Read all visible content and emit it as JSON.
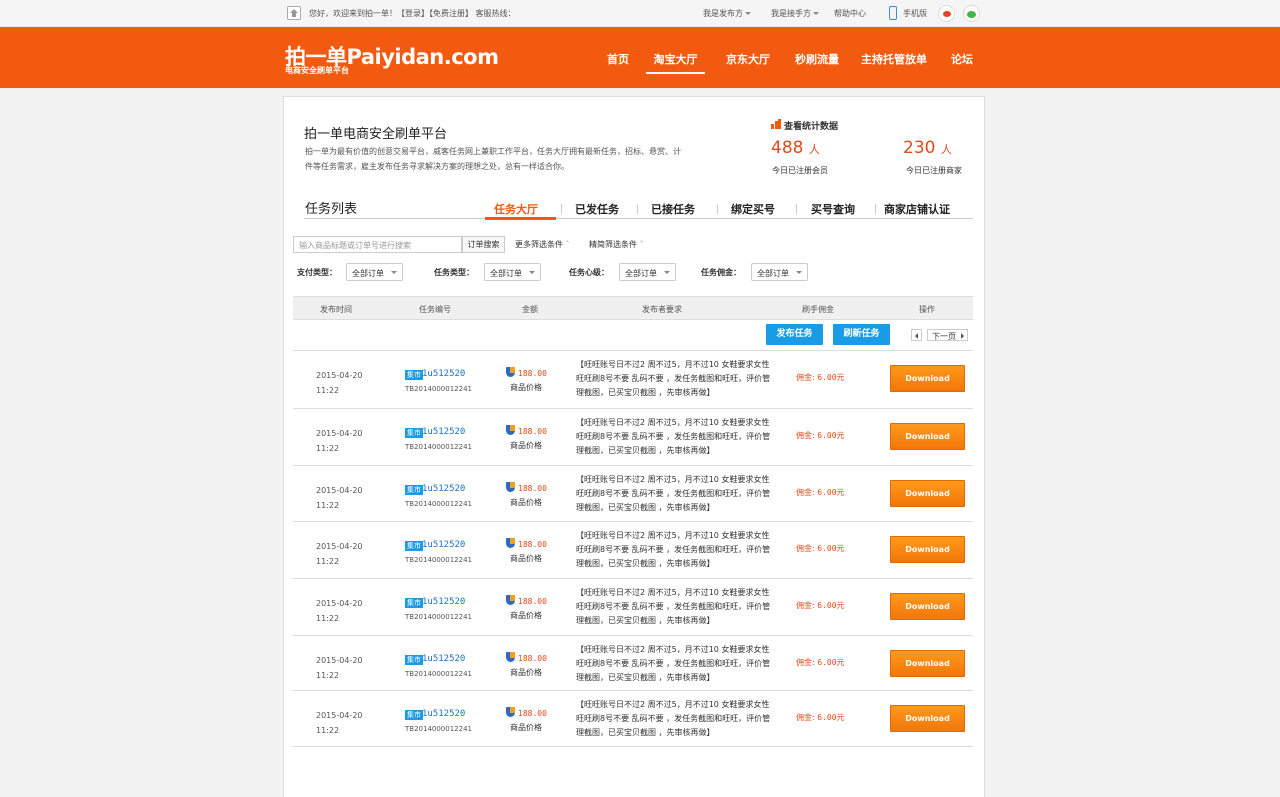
{
  "topbar": {
    "welcome": "您好，欢迎来到拍一单！【登录】【免费注册】",
    "hotline": "客服热线：",
    "links": [
      "我是发布方",
      "我是接手方",
      "帮助中心",
      "手机版"
    ]
  },
  "header": {
    "logo": "拍一单Paiyidan.com",
    "slogan": "电商安全刷单平台",
    "nav": [
      "首页",
      "淘宝大厅",
      "京东大厅",
      "秒刷流量",
      "主持托管放单",
      "论坛"
    ]
  },
  "intro": {
    "title": "拍一单电商安全刷单平台",
    "text": "拍一单为最有价值的创意交易平台，威客任务网上兼职工作平台，任务大厅拥有最新任务，招标、悬赏、计件等任务需求，雇主发布任务寻求解决方案的理想之处，总有一样适合你。"
  },
  "stats": {
    "title": "查看统计数据",
    "members_num": "488",
    "members_unit": "人",
    "members_label": "今日已注册会员",
    "merchants_num": "230",
    "merchants_unit": "人",
    "merchants_label": "今日已注册商家"
  },
  "task_list": {
    "title": "任务列表",
    "tabs": [
      "任务大厅",
      "已发任务",
      "已接任务",
      "绑定买号",
      "买号查询",
      "商家店铺认证"
    ]
  },
  "filters": {
    "search_placeholder": "输入商品标题或订单号进行搜索",
    "search_button": "订单搜索",
    "more": "更多筛选条件",
    "fine": "精简筛选条件",
    "labels": [
      "支付类型：",
      "任务类型：",
      "任务心级：",
      "任务佣金："
    ],
    "values": [
      "全部订单",
      "全部订单",
      "全部订单",
      "全部订单"
    ]
  },
  "table": {
    "headers": [
      "发布时间",
      "任务编号",
      "金额",
      "发布者要求",
      "刷手佣金",
      "操作"
    ],
    "publish_button": "发布任务",
    "refresh_button": "刷新任务",
    "next_page": "下一页",
    "rows": [
      {
        "date": "2015-04-20",
        "time": "11:22",
        "tag": "集市",
        "id": "1u512520",
        "tb": "TB2014000012241",
        "price": "188.00",
        "price_label": "商品价格",
        "req": "【旺旺账号日不过2 周不过5，月不过10 女鞋要求女性旺旺刷8号不要 乱码不要 ，发任务截图和旺旺，评价管理截图，已买宝贝截图 ，先审核再做】",
        "comm_label": "佣金:",
        "comm": "6.00元",
        "action": "Download"
      },
      {
        "date": "2015-04-20",
        "time": "11:22",
        "tag": "集市",
        "id": "1u512520",
        "tb": "TB2014000012241",
        "price": "188.00",
        "price_label": "商品价格",
        "req": "【旺旺账号日不过2 周不过5，月不过10 女鞋要求女性旺旺刷8号不要 乱码不要 ，发任务截图和旺旺，评价管理截图，已买宝贝截图 ，先审核再做】",
        "comm_label": "佣金:",
        "comm": "6.00元",
        "action": "Download"
      },
      {
        "date": "2015-04-20",
        "time": "11:22",
        "tag": "集市",
        "id": "1u512520",
        "tb": "TB2014000012241",
        "price": "188.00",
        "price_label": "商品价格",
        "req": "【旺旺账号日不过2 周不过5，月不过10 女鞋要求女性旺旺刷8号不要 乱码不要 ，发任务截图和旺旺，评价管理截图，已买宝贝截图 ，先审核再做】",
        "comm_label": "佣金:",
        "comm": "6.00元",
        "action": "Download"
      },
      {
        "date": "2015-04-20",
        "time": "11:22",
        "tag": "集市",
        "id": "1u512520",
        "tb": "TB2014000012241",
        "price": "188.00",
        "price_label": "商品价格",
        "req": "【旺旺账号日不过2 周不过5，月不过10 女鞋要求女性旺旺刷8号不要 乱码不要 ，发任务截图和旺旺，评价管理截图，已买宝贝截图 ，先审核再做】",
        "comm_label": "佣金:",
        "comm": "6.00元",
        "action": "Download"
      },
      {
        "date": "2015-04-20",
        "time": "11:22",
        "tag": "集市",
        "id": "1u512520",
        "tb": "TB2014000012241",
        "price": "188.00",
        "price_label": "商品价格",
        "req": "【旺旺账号日不过2 周不过5，月不过10 女鞋要求女性旺旺刷8号不要 乱码不要 ，发任务截图和旺旺，评价管理截图，已买宝贝截图 ，先审核再做】",
        "comm_label": "佣金:",
        "comm": "6.00元",
        "action": "Download"
      },
      {
        "date": "2015-04-20",
        "time": "11:22",
        "tag": "集市",
        "id": "1u512520",
        "tb": "TB2014000012241",
        "price": "188.00",
        "price_label": "商品价格",
        "req": "【旺旺账号日不过2 周不过5，月不过10 女鞋要求女性旺旺刷8号不要 乱码不要 ，发任务截图和旺旺，评价管理截图，已买宝贝截图 ，先审核再做】",
        "comm_label": "佣金:",
        "comm": "6.00元",
        "action": "Download"
      },
      {
        "date": "2015-04-20",
        "time": "11:22",
        "tag": "集市",
        "id": "1u512520",
        "tb": "TB2014000012241",
        "price": "188.00",
        "price_label": "商品价格",
        "req": "【旺旺账号日不过2 周不过5，月不过10 女鞋要求女性旺旺刷8号不要 乱码不要 ，发任务截图和旺旺，评价管理截图，已买宝贝截图 ，先审核再做】",
        "comm_label": "佣金:",
        "comm": "6.00元",
        "action": "Download"
      }
    ]
  },
  "colors": {
    "brand": "#f15a0f",
    "accent_blue": "#1a9be6",
    "price_red": "#e14a1a",
    "download_orange": "#f58a12"
  }
}
